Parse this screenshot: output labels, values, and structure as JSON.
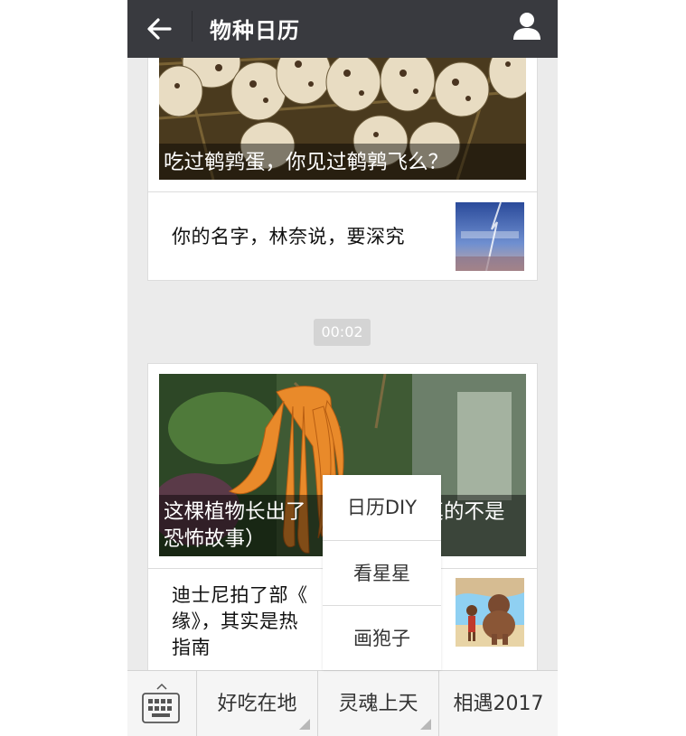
{
  "header": {
    "title": "物种日历",
    "back_icon": "arrow-left-icon",
    "user_icon": "person-icon"
  },
  "feed": {
    "card1": {
      "hero_caption": "吃过鹌鹑蛋，你见过鹌鹑飞么？",
      "item_text": "你的名字，林奈说，要深究"
    },
    "timestamp": "00:02",
    "card2": {
      "hero_caption_line1": "这棵植物长出了",
      "hero_caption_hidden_tail": "真的不是",
      "hero_caption_line2": "恐怖故事）",
      "item_line1": "迪士尼拍了部《",
      "item_line2": "缘》，其实是热",
      "item_line3": "指南"
    }
  },
  "popup_menu": {
    "items": [
      "日历DIY",
      "看星星",
      "画狍子"
    ]
  },
  "bottom_menu": {
    "keyboard_icon": "keyboard-icon",
    "tabs": [
      "好吃在地",
      "灵魂上天",
      "相遇2017"
    ]
  },
  "colors": {
    "header_bg": "#393a3f",
    "page_bg": "#ebebeb",
    "card_bg": "#ffffff",
    "timestamp_bg": "#d4d4d4"
  }
}
